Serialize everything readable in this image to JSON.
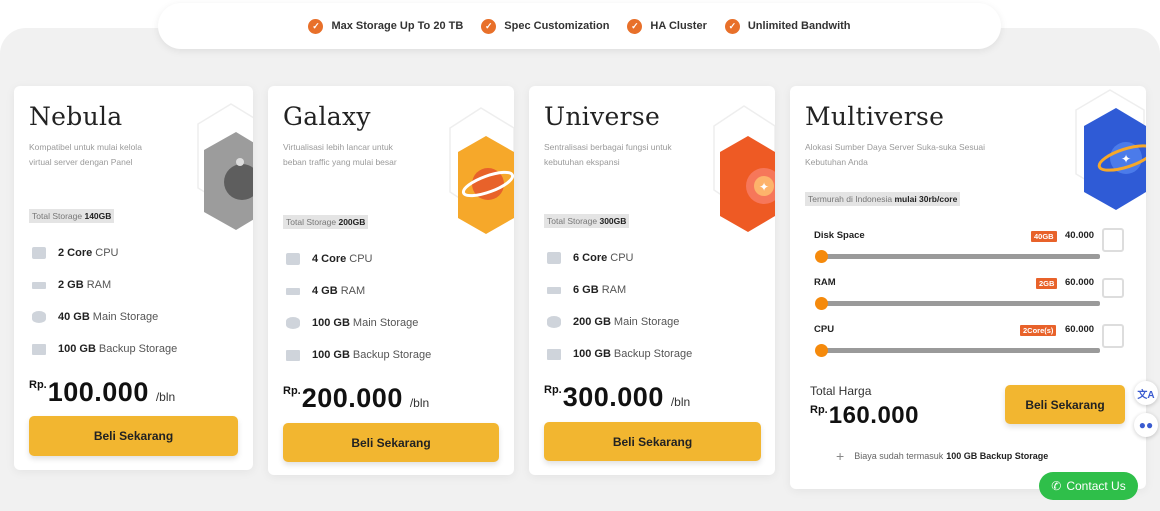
{
  "features": [
    {
      "label": "Max Storage Up To 20 TB",
      "icon": "check-icon"
    },
    {
      "label": "Spec Customization",
      "icon": "check-icon"
    },
    {
      "label": "HA Cluster",
      "icon": "check-icon"
    },
    {
      "label": "Unlimited Bandwith",
      "icon": "check-icon"
    }
  ],
  "colors": {
    "accent": "#f2b630",
    "check": "#e8702a",
    "slider_knob": "#f58a0c",
    "badge": "#e8622a",
    "contact": "#2fbf4a"
  },
  "plans": [
    {
      "name": "Nebula",
      "desc": "Kompatibel untuk mulai kelola virtual server dengan Panel",
      "storage_label": "Total Storage",
      "storage_value": "140GB",
      "specs": [
        {
          "value": "2 Core",
          "unit": "CPU",
          "icon": "cpu-icon"
        },
        {
          "value": "2 GB",
          "unit": "RAM",
          "icon": "ram-icon"
        },
        {
          "value": "40 GB",
          "unit": "Main Storage",
          "icon": "storage-icon"
        },
        {
          "value": "100 GB",
          "unit": "Backup Storage",
          "icon": "backup-icon"
        }
      ],
      "currency": "Rp.",
      "price": "100.000",
      "period": "/bln",
      "button": "Beli Sekarang"
    },
    {
      "name": "Galaxy",
      "desc": "Virtualisasi lebih lancar untuk beban traffic yang mulai besar",
      "storage_label": "Total Storage",
      "storage_value": "200GB",
      "specs": [
        {
          "value": "4 Core",
          "unit": "CPU",
          "icon": "cpu-icon"
        },
        {
          "value": "4 GB",
          "unit": "RAM",
          "icon": "ram-icon"
        },
        {
          "value": "100 GB",
          "unit": "Main Storage",
          "icon": "storage-icon"
        },
        {
          "value": "100 GB",
          "unit": "Backup Storage",
          "icon": "backup-icon"
        }
      ],
      "currency": "Rp.",
      "price": "200.000",
      "period": "/bln",
      "button": "Beli Sekarang"
    },
    {
      "name": "Universe",
      "desc": "Sentralisasi berbagai fungsi untuk kebutuhan ekspansi",
      "storage_label": "Total Storage",
      "storage_value": "300GB",
      "specs": [
        {
          "value": "6 Core",
          "unit": "CPU",
          "icon": "cpu-icon"
        },
        {
          "value": "6 GB",
          "unit": "RAM",
          "icon": "ram-icon"
        },
        {
          "value": "200 GB",
          "unit": "Main Storage",
          "icon": "storage-icon"
        },
        {
          "value": "100 GB",
          "unit": "Backup Storage",
          "icon": "backup-icon"
        }
      ],
      "currency": "Rp.",
      "price": "300.000",
      "period": "/bln",
      "button": "Beli Sekarang"
    }
  ],
  "custom": {
    "name": "Multiverse",
    "desc": "Alokasi Sumber Daya Server Suka-suka Sesuai Kebutuhan Anda",
    "promo_prefix": "Termurah di Indonesia",
    "promo_bold": "mulai 30rb/core",
    "sliders": [
      {
        "label": "Disk Space",
        "badge": "40GB",
        "price": "40.000",
        "level": 0,
        "icon": "disk-icon"
      },
      {
        "label": "RAM",
        "badge": "2GB",
        "price": "60.000",
        "level": 0,
        "icon": "ram-icon"
      },
      {
        "label": "CPU",
        "badge": "2Core(s)",
        "price": "60.000",
        "level": 0,
        "icon": "cpu-chip-icon"
      }
    ],
    "total_label": "Total Harga",
    "currency": "Rp.",
    "total_price": "160.000",
    "button": "Beli Sekarang",
    "note_prefix": "Biaya sudah termasuk",
    "note_bold": "100 GB Backup Storage"
  },
  "floating": {
    "translate_icon": "translate-icon",
    "chatbot_icon": "chatbot-icon",
    "contact_label": "Contact Us"
  }
}
